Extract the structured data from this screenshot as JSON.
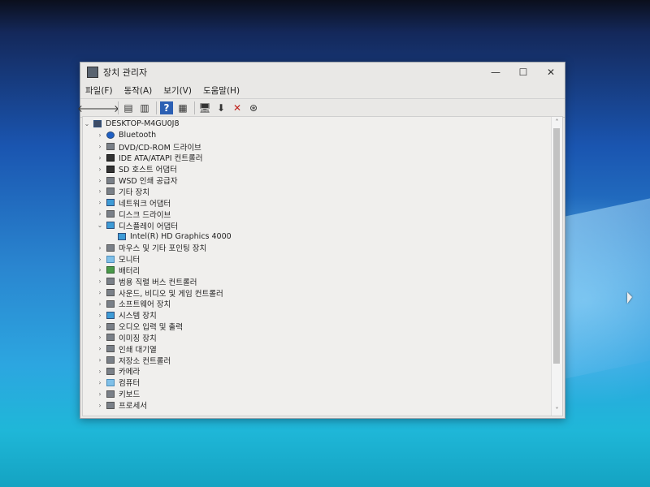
{
  "window": {
    "title": "장치 관리자",
    "controls": {
      "minimize": "—",
      "maximize": "☐",
      "close": "✕"
    }
  },
  "menu": {
    "items": [
      "파일(F)",
      "동작(A)",
      "보기(V)",
      "도움말(H)"
    ]
  },
  "toolbar": {
    "buttons": [
      {
        "name": "back-arrow-icon",
        "glyph": "🡐"
      },
      {
        "name": "forward-arrow-icon",
        "glyph": "🡒"
      },
      {
        "name": "properties-icon",
        "glyph": "▤"
      },
      {
        "name": "show-hide-icon",
        "glyph": "▥"
      },
      {
        "name": "help-icon",
        "glyph": "?"
      },
      {
        "name": "view-icon",
        "glyph": "▦"
      },
      {
        "name": "scan-hardware-icon",
        "glyph": "🖥"
      },
      {
        "name": "update-driver-icon",
        "glyph": "⬇"
      },
      {
        "name": "uninstall-icon",
        "glyph": "✕"
      },
      {
        "name": "disable-icon",
        "glyph": "⊛"
      }
    ]
  },
  "tree": {
    "root": "DESKTOP-M4GU0J8",
    "items": [
      {
        "label": "Bluetooth",
        "icon": "bt",
        "expanded": false,
        "depth": 1
      },
      {
        "label": "DVD/CD-ROM 드라이브",
        "icon": "gray",
        "expanded": false,
        "depth": 1
      },
      {
        "label": "IDE ATA/ATAPI 컨트롤러",
        "icon": "dark",
        "expanded": false,
        "depth": 1
      },
      {
        "label": "SD 호스트 어댑터",
        "icon": "dark",
        "expanded": false,
        "depth": 1
      },
      {
        "label": "WSD 인쇄 공급자",
        "icon": "gray",
        "expanded": false,
        "depth": 1
      },
      {
        "label": "기타 장치",
        "icon": "gray",
        "expanded": false,
        "depth": 1
      },
      {
        "label": "네트워크 어댑터",
        "icon": "disp",
        "expanded": false,
        "depth": 1
      },
      {
        "label": "디스크 드라이브",
        "icon": "gray",
        "expanded": false,
        "depth": 1
      },
      {
        "label": "디스플레이 어댑터",
        "icon": "disp",
        "expanded": true,
        "depth": 1
      },
      {
        "label": "Intel(R) HD Graphics 4000",
        "icon": "disp",
        "expanded": null,
        "depth": 2
      },
      {
        "label": "마우스 및 기타 포인팅 장치",
        "icon": "gray",
        "expanded": false,
        "depth": 1
      },
      {
        "label": "모니터",
        "icon": "lightblue",
        "expanded": false,
        "depth": 1
      },
      {
        "label": "배터리",
        "icon": "green",
        "expanded": false,
        "depth": 1
      },
      {
        "label": "범용 직렬 버스 컨트롤러",
        "icon": "gray",
        "expanded": false,
        "depth": 1
      },
      {
        "label": "사운드, 비디오 및 게임 컨트롤러",
        "icon": "gray",
        "expanded": false,
        "depth": 1
      },
      {
        "label": "소프트웨어 장치",
        "icon": "gray",
        "expanded": false,
        "depth": 1
      },
      {
        "label": "시스템 장치",
        "icon": "disp",
        "expanded": false,
        "depth": 1
      },
      {
        "label": "오디오 입력 및 출력",
        "icon": "gray",
        "expanded": false,
        "depth": 1
      },
      {
        "label": "이미징 장치",
        "icon": "gray",
        "expanded": false,
        "depth": 1
      },
      {
        "label": "인쇄 대기열",
        "icon": "gray",
        "expanded": false,
        "depth": 1
      },
      {
        "label": "저장소 컨트롤러",
        "icon": "gray",
        "expanded": false,
        "depth": 1
      },
      {
        "label": "카메라",
        "icon": "gray",
        "expanded": false,
        "depth": 1
      },
      {
        "label": "컴퓨터",
        "icon": "lightblue",
        "expanded": false,
        "depth": 1
      },
      {
        "label": "키보드",
        "icon": "gray",
        "expanded": false,
        "depth": 1
      },
      {
        "label": "프로세서",
        "icon": "gray",
        "expanded": false,
        "depth": 1
      }
    ]
  },
  "scrollbar": {
    "up": "˄",
    "down": "˅"
  }
}
